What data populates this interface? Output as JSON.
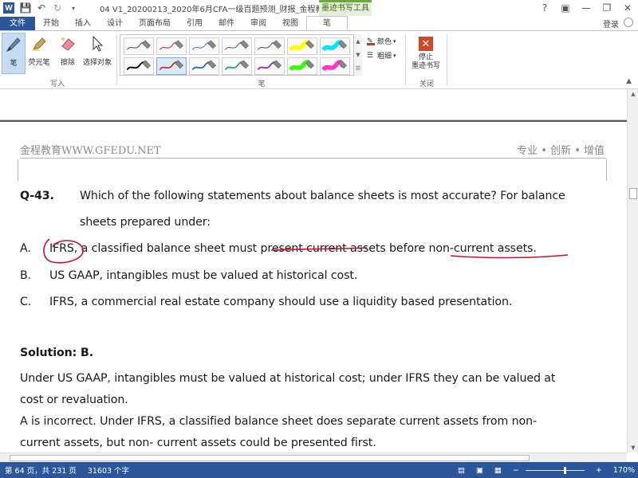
{
  "app": {
    "title": "04 V1_20200213_2020年6月CFA一级百题预测_财报_金程教育...",
    "ink_tools_context": "墨迹书写工具",
    "login": "登录",
    "window_buttons": [
      "?",
      "minimize-icon",
      "restore-icon",
      "close-icon"
    ]
  },
  "tabs": [
    {
      "label": "文件"
    },
    {
      "label": "开始"
    },
    {
      "label": "插入"
    },
    {
      "label": "设计"
    },
    {
      "label": "页面布局"
    },
    {
      "label": "引用"
    },
    {
      "label": "邮件"
    },
    {
      "label": "审阅"
    },
    {
      "label": "视图"
    },
    {
      "label": "笔"
    }
  ],
  "ribbon": {
    "write_group": {
      "label": "写入",
      "buttons": [
        {
          "label": "笔",
          "icon": "pen-icon"
        },
        {
          "label": "荧光笔",
          "icon": "highlighter-icon"
        },
        {
          "label": "擦除",
          "icon": "eraser-icon"
        },
        {
          "label": "选择对象",
          "icon": "select-arrow-icon"
        }
      ]
    },
    "pen_group": {
      "label": "笔",
      "color_label": "颜色",
      "thickness_label": "粗细",
      "pens": [
        {
          "color": "#555555"
        },
        {
          "color": "#c0392b"
        },
        {
          "color": "#5b7fa8"
        },
        {
          "color": "#2e8b57"
        },
        {
          "color": "#555555"
        },
        {
          "color": "#ffff00"
        },
        {
          "color": "#00e5ff"
        },
        {
          "color": "#000000"
        },
        {
          "color": "#c0392b"
        },
        {
          "color": "#2b6cb0"
        },
        {
          "color": "#27ae60"
        },
        {
          "color": "#8a2be2"
        },
        {
          "color": "#33ff00"
        },
        {
          "color": "#ff33cc"
        }
      ]
    },
    "close_group": {
      "label": "关闭",
      "stop_label_line1": "停止",
      "stop_label_line2": "墨迹书写"
    }
  },
  "document": {
    "header_left": "金程教育WWW.GFEDU.NET",
    "header_right": "专业 • 创新 • 增值",
    "question_id": "Q-43.",
    "question_line1": "Which of the following statements about balance sheets is most accurate? For balance",
    "question_line2": "sheets prepared under:",
    "options": [
      {
        "letter": "A.",
        "text": "IFRS, a classified balance sheet must present current assets before non-current assets."
      },
      {
        "letter": "B.",
        "text": "US GAAP, intangibles must be valued at historical cost."
      },
      {
        "letter": "C.",
        "text": "IFRS, a commercial real estate company should use a liquidity based presentation."
      }
    ],
    "solution_title": "Solution: B.",
    "solution_lines": [
      "Under US GAAP, intangibles must be valued at historical cost; under IFRS they can be valued at",
      "cost or revaluation.",
      "A is incorrect. Under IFRS, a classified balance sheet does separate current assets from non-",
      "current assets, but non- current assets could be presented first."
    ],
    "ink_color": "#c8102e"
  },
  "status": {
    "page": "第 64 页，共 231 页",
    "words": "31603 个字",
    "zoom": "170%"
  }
}
